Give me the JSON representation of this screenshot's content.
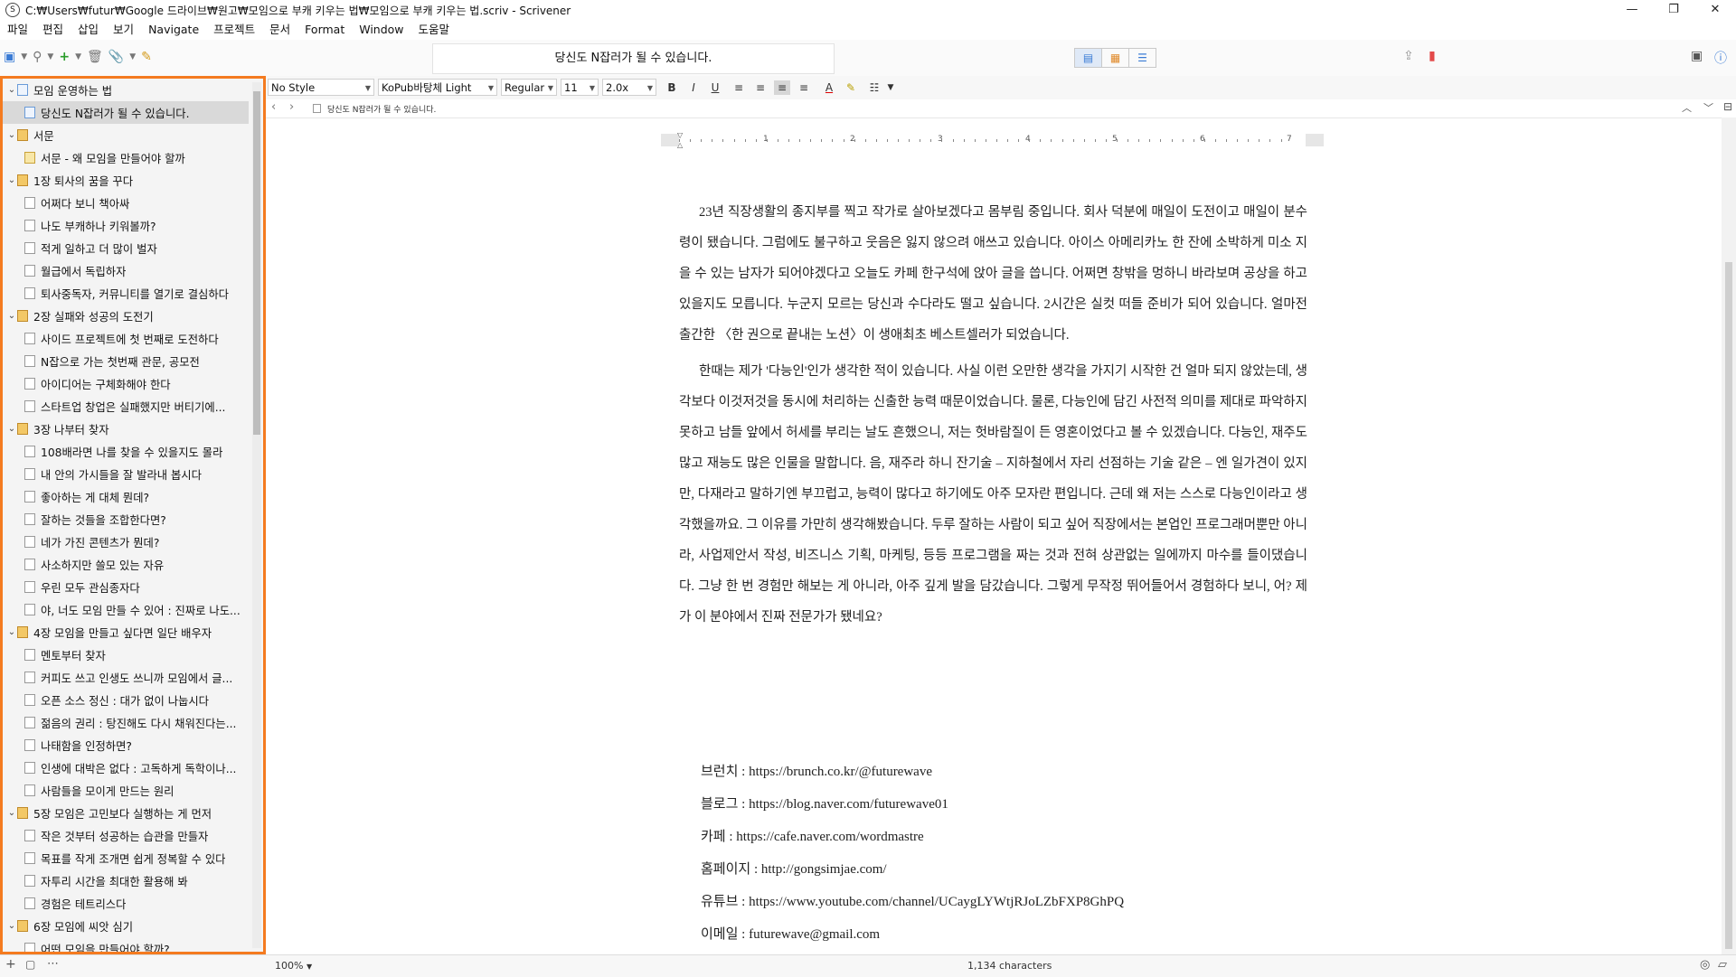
{
  "window": {
    "title": "C:₩Users₩futur₩Google 드라이브₩원고₩모임으로 부캐 키우는 법₩모임으로 부캐 키우는 법.scriv - Scrivener",
    "minimize": "—",
    "maximize": "❐",
    "close": "✕"
  },
  "menu": [
    "파일",
    "편집",
    "삽입",
    "보기",
    "Navigate",
    "프로젝트",
    "문서",
    "Format",
    "Window",
    "도움말"
  ],
  "toolbar": {
    "document_title": "당신도 N잡러가 될 수 있습니다."
  },
  "format_bar": {
    "style": "No Style",
    "font": "KoPub바탕체 Light",
    "weight": "Regular",
    "size": "11",
    "line_spacing": "2.0x",
    "bold": "B",
    "italic": "I",
    "underline": "U"
  },
  "path": {
    "current_doc": "당신도 N잡러가 될 수 있습니다."
  },
  "binder": [
    {
      "level": 0,
      "type": "docblue",
      "chev": "⌄",
      "label": "모임 운영하는 법"
    },
    {
      "level": 1,
      "type": "docblue",
      "chev": "",
      "label": "당신도 N잡러가 될 수 있습니다.",
      "selected": true
    },
    {
      "level": 0,
      "type": "folder",
      "chev": "⌄",
      "label": "서문"
    },
    {
      "level": 1,
      "type": "docyel",
      "chev": "",
      "label": "서문 - 왜 모임을 만들어야 할까"
    },
    {
      "level": 0,
      "type": "folder",
      "chev": "⌄",
      "label": "1장 퇴사의 꿈을 꾸다"
    },
    {
      "level": 1,
      "type": "doc",
      "chev": "",
      "label": "어쩌다 보니 책아싸"
    },
    {
      "level": 1,
      "type": "doc",
      "chev": "",
      "label": "나도 부캐하나 키워볼까?"
    },
    {
      "level": 1,
      "type": "doc",
      "chev": "",
      "label": "적게 일하고 더 많이 벌자"
    },
    {
      "level": 1,
      "type": "doc",
      "chev": "",
      "label": "월급에서 독립하자"
    },
    {
      "level": 1,
      "type": "doc",
      "chev": "",
      "label": "퇴사중독자, 커뮤니티를 열기로 결심하다"
    },
    {
      "level": 0,
      "type": "folder",
      "chev": "⌄",
      "label": "2장 실패와 성공의 도전기"
    },
    {
      "level": 1,
      "type": "doc",
      "chev": "",
      "label": "사이드 프로젝트에 첫 번째로 도전하다"
    },
    {
      "level": 1,
      "type": "doc",
      "chev": "",
      "label": "N잡으로 가는 첫번째 관문, 공모전"
    },
    {
      "level": 1,
      "type": "doc",
      "chev": "",
      "label": "아이디어는 구체화해야 한다"
    },
    {
      "level": 1,
      "type": "doc",
      "chev": "",
      "label": "스타트업 창업은 실패했지만 버티기에..."
    },
    {
      "level": 0,
      "type": "folder",
      "chev": "⌄",
      "label": "3장 나부터 찾자"
    },
    {
      "level": 1,
      "type": "doc",
      "chev": "",
      "label": "108배라면 나를 찾을 수 있을지도 몰라"
    },
    {
      "level": 1,
      "type": "doc",
      "chev": "",
      "label": "내 안의 가시들을 잘 발라내 봅시다"
    },
    {
      "level": 1,
      "type": "doc",
      "chev": "",
      "label": "좋아하는 게 대체 뭔데?"
    },
    {
      "level": 1,
      "type": "doc",
      "chev": "",
      "label": "잘하는 것들을 조합한다면?"
    },
    {
      "level": 1,
      "type": "doc",
      "chev": "",
      "label": "네가 가진 콘텐츠가 뭔데?"
    },
    {
      "level": 1,
      "type": "doc",
      "chev": "",
      "label": "사소하지만 쓸모 있는 자유"
    },
    {
      "level": 1,
      "type": "doc",
      "chev": "",
      "label": "우린 모두 관심종자다"
    },
    {
      "level": 1,
      "type": "doc",
      "chev": "",
      "label": "야, 너도 모임 만들 수 있어 : 진짜로 나도..."
    },
    {
      "level": 0,
      "type": "folder",
      "chev": "⌄",
      "label": "4장 모임을 만들고 싶다면 일단 배우자"
    },
    {
      "level": 1,
      "type": "doc",
      "chev": "",
      "label": "멘토부터 찾자"
    },
    {
      "level": 1,
      "type": "doc",
      "chev": "",
      "label": "커피도 쓰고 인생도 쓰니까 모임에서 글..."
    },
    {
      "level": 1,
      "type": "doc",
      "chev": "",
      "label": "오픈 소스 정신 : 대가 없이 나눕시다"
    },
    {
      "level": 1,
      "type": "doc",
      "chev": "",
      "label": "젊음의 권리 : 탕진해도 다시 채워진다는..."
    },
    {
      "level": 1,
      "type": "doc",
      "chev": "",
      "label": "나태함을 인정하면?"
    },
    {
      "level": 1,
      "type": "doc",
      "chev": "",
      "label": "인생에 대박은 없다 : 고독하게 독학이나..."
    },
    {
      "level": 1,
      "type": "doc",
      "chev": "",
      "label": "사람들을 모이게 만드는 원리"
    },
    {
      "level": 0,
      "type": "folder",
      "chev": "⌄",
      "label": "5장 모임은 고민보다 실행하는 게 먼저"
    },
    {
      "level": 1,
      "type": "doc",
      "chev": "",
      "label": "작은 것부터 성공하는 습관을 만들자"
    },
    {
      "level": 1,
      "type": "doc",
      "chev": "",
      "label": "목표를 작게 조개면 쉽게 정복할 수 있다"
    },
    {
      "level": 1,
      "type": "doc",
      "chev": "",
      "label": "자투리 시간을 최대한 활용해 봐"
    },
    {
      "level": 1,
      "type": "doc",
      "chev": "",
      "label": "경험은 테트리스다"
    },
    {
      "level": 0,
      "type": "folder",
      "chev": "⌄",
      "label": "6장 모임에 씨앗 심기"
    },
    {
      "level": 1,
      "type": "doc",
      "chev": "",
      "label": "어떤 모임을 만들어야 할까?"
    }
  ],
  "editor": {
    "paragraphs": [
      "23년 직장생활의 종지부를 찍고 작가로 살아보겠다고 몸부림 중입니다. 회사 덕분에 매일이 도전이고 매일이 분수령이 됐습니다. 그럼에도 불구하고 웃음은 잃지 않으려 애쓰고 있습니다. 아이스 아메리카노 한 잔에 소박하게 미소 지을 수 있는 남자가 되어야겠다고 오늘도 카페 한구석에 앉아 글을 씁니다. 어쩌면 창밖을 멍하니 바라보며 공상을 하고 있을지도 모릅니다. 누군지 모르는 당신과 수다라도 떨고 싶습니다. 2시간은 실컷 떠들 준비가 되어 있습니다. 얼마전 출간한 〈한 권으로 끝내는 노션〉이 생애최초 베스트셀러가 되었습니다.",
      "한때는 제가 '다능인'인가 생각한 적이 있습니다. 사실 이런 오만한 생각을 가지기 시작한 건 얼마 되지 않았는데, 생각보다 이것저것을 동시에 처리하는 신출한 능력 때문이었습니다. 물론, 다능인에 담긴 사전적 의미를 제대로 파악하지 못하고 남들 앞에서 허세를 부리는 날도 흔했으니, 저는 헛바람질이 든 영혼이었다고 볼 수 있겠습니다. 다능인, 재주도 많고 재능도 많은 인물을 말합니다. 음, 재주라 하니 잔기술 – 지하철에서 자리 선점하는 기술 같은 – 엔 일가견이 있지만, 다재라고 말하기엔 부끄럽고, 능력이 많다고 하기에도 아주 모자란 편입니다. 근데 왜 저는 스스로 다능인이라고 생각했을까요. 그 이유를 가만히 생각해봤습니다. 두루 잘하는 사람이 되고 싶어 직장에서는 본업인 프로그래머뿐만 아니라, 사업제안서 작성, 비즈니스 기획, 마케팅, 등등 프로그램을 짜는 것과 전혀 상관없는 일에까지 마수를 들이댔습니다. 그냥 한 번 경험만 해보는 게 아니라, 아주 깊게 발을 담갔습니다. 그렇게 무작정 뛰어들어서 경험하다 보니, 어? 제가 이 분야에서 진짜 전문가가 됐네요?"
    ],
    "links": [
      "브런치 : https://brunch.co.kr/@futurewave",
      "블로그 : https://blog.naver.com/futurewave01",
      "카페 : https://cafe.naver.com/wordmastre",
      "홈페이지 : http://gongsimjae.com/",
      "유튜브 : https://www.youtube.com/channel/UCaygLYWtjRJoLZbFXP8GhPQ",
      "이메일 : futurewave@gmail.com"
    ]
  },
  "status": {
    "zoom": "100%",
    "char_count": "1,134 characters"
  },
  "colors": {
    "binder_highlight": "#f47b20",
    "accent": "#3a7bd5"
  }
}
